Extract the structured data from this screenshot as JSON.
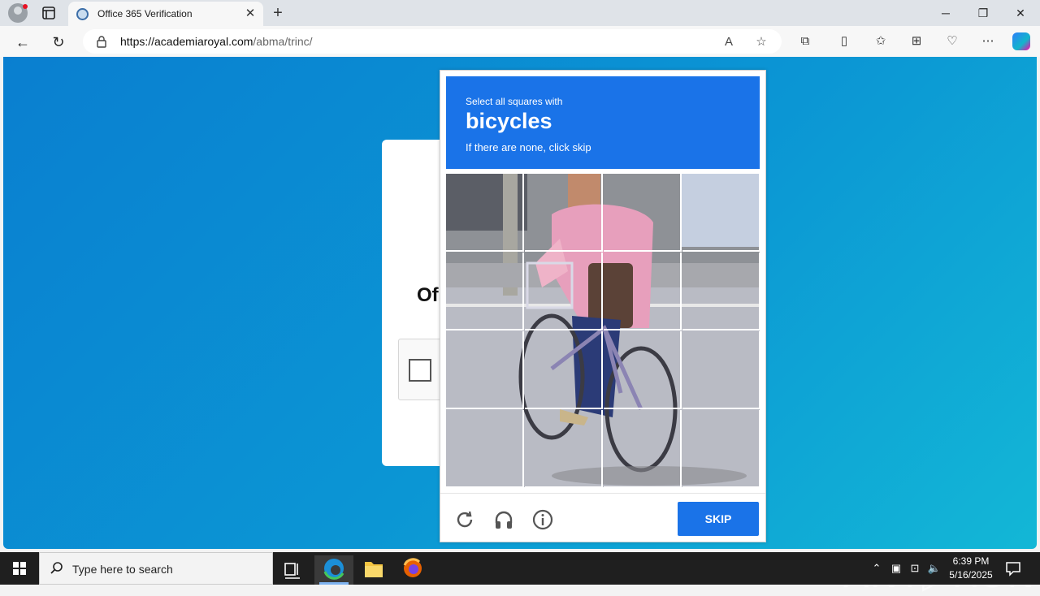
{
  "browser": {
    "tab_title": "Office 365 Verification",
    "new_tab_glyph": "+",
    "url_host": "https://academiaroyal.com",
    "url_path": "/abma/trinc/",
    "icons": [
      "profile-icon",
      "tab-actions-icon",
      "favicon",
      "tab-close-icon",
      "back-icon",
      "refresh-icon",
      "lock-icon",
      "read-aloud-icon",
      "favorite-star-icon",
      "extensions-icon",
      "split-screen-icon",
      "favorites-icon",
      "collections-icon",
      "browser-essentials-icon",
      "more-icon",
      "copilot-icon",
      "minimize-icon",
      "restore-icon",
      "window-close-icon"
    ]
  },
  "page": {
    "card_heading_partial": "Of"
  },
  "captcha": {
    "instruction_line1": "Select all squares with",
    "target_word": "bicycles",
    "instruction_line3": "If there are none, click skip",
    "grid_rows": 4,
    "grid_cols": 4,
    "skip_label": "SKIP",
    "footer_icons": [
      "reload-icon",
      "audio-headphones-icon",
      "info-icon"
    ],
    "header_color": "#1a73e8"
  },
  "watermark": "ANY▷RUN",
  "taskbar": {
    "search_placeholder": "Type here to search",
    "time": "6:39 PM",
    "date": "5/16/2025",
    "apps": [
      "task-view-icon",
      "edge-icon",
      "file-explorer-icon",
      "firefox-icon"
    ]
  }
}
